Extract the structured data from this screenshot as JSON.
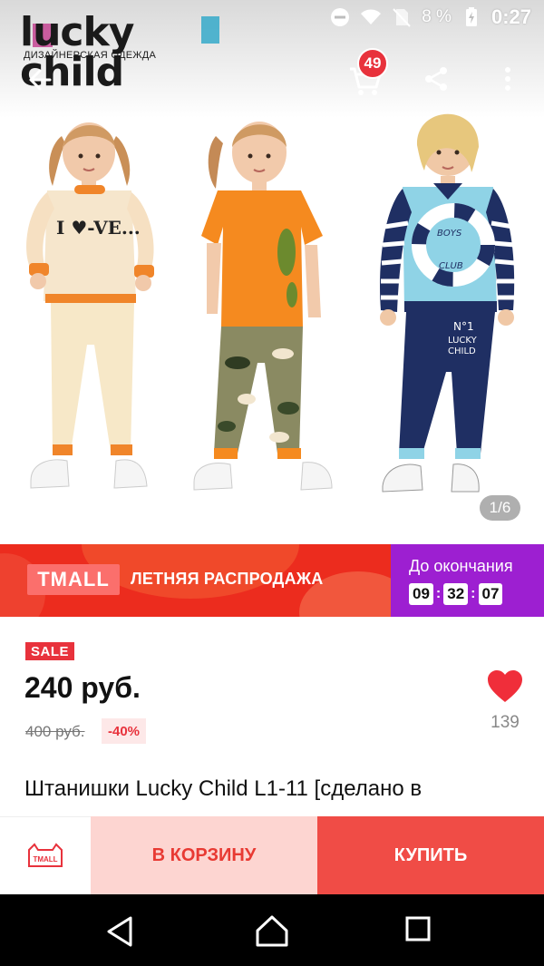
{
  "status_bar": {
    "battery_percent": "8 %",
    "time": "0:27",
    "icons": [
      "do-not-disturb-icon",
      "wifi-icon",
      "no-sim-icon",
      "battery-charging-icon"
    ]
  },
  "brand_logo": {
    "name": "lucky child",
    "tagline": "ДИЗАЙНЕРСКАЯ ОДЕЖДА"
  },
  "toolbar": {
    "back_icon": "arrow-left-icon",
    "cart_icon": "cart-icon",
    "cart_count": "49",
    "share_icon": "share-icon",
    "more_icon": "more-vertical-icon"
  },
  "gallery": {
    "counter": "1/6",
    "shirt_texts": [
      "I ♥-VE...",
      "BOYS",
      "CLUB",
      "N°1",
      "LUCKY",
      "CHILD"
    ]
  },
  "promo_banner": {
    "tmall_label": "TMALL",
    "title": "ЛЕТНЯЯ РАСПРОДАЖА",
    "until_label": "До окончания",
    "timer": {
      "hours": "09",
      "minutes": "32",
      "seconds": "07",
      "separator": ":"
    },
    "colors": {
      "red": "#ec2c1e",
      "purple": "#9d1fd1"
    }
  },
  "product": {
    "sale_badge": "SALE",
    "price": "240 руб.",
    "old_price": "400 руб.",
    "discount": "-40%",
    "wishlist_count": "139",
    "title": "Штанишки Lucky Child L1-11 [сделано в"
  },
  "actions": {
    "store_label": "TMALL",
    "add_to_cart": "В КОРЗИНУ",
    "buy": "КУПИТЬ",
    "colors": {
      "accent": "#f04c46",
      "light": "#fdd5d1"
    }
  },
  "system_nav": {
    "back_icon": "nav-back-icon",
    "home_icon": "nav-home-icon",
    "recents_icon": "nav-recents-icon"
  }
}
